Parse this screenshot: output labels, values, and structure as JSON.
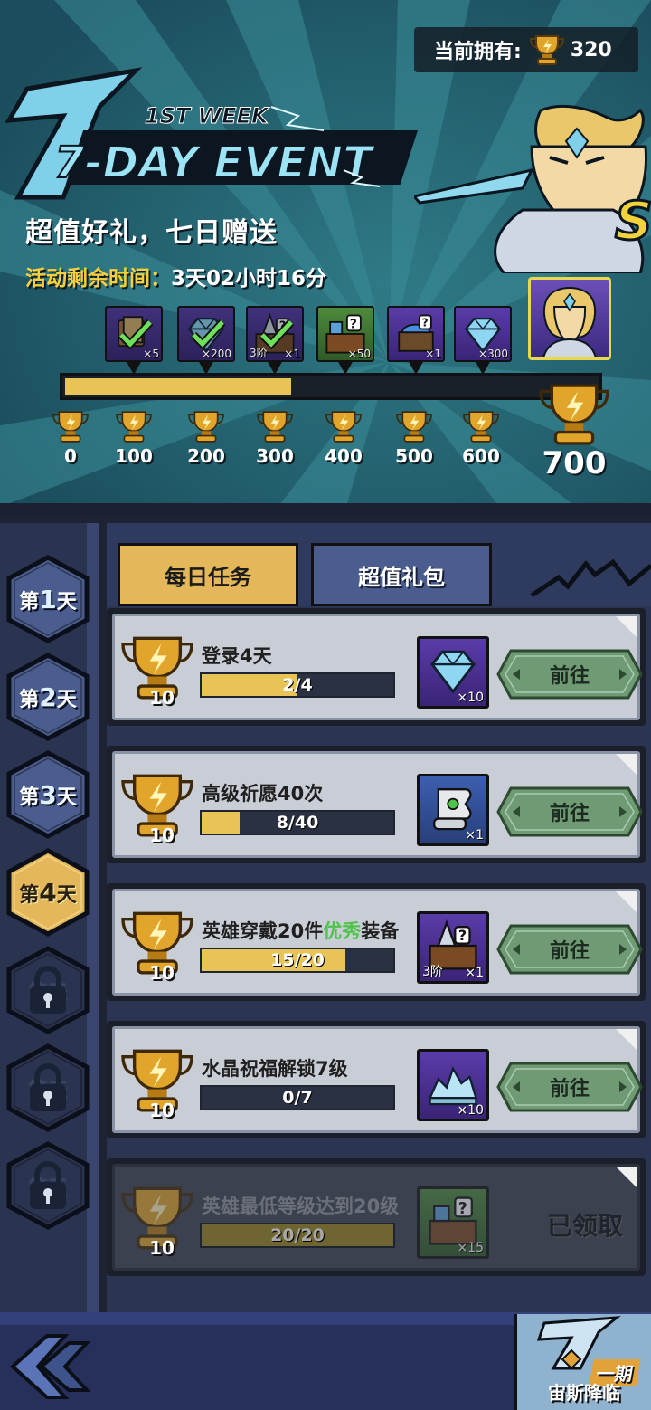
{
  "header": {
    "owned_label": "当前拥有:",
    "owned_value": "320",
    "logo_week": "1ST WEEK",
    "logo_title": "7-DAY EVENT",
    "subtitle": "超值好礼，七日赠送",
    "timer_label": "活动剩余时间：",
    "timer_value": "3天02小时16分",
    "hero_grade": "S"
  },
  "progress": {
    "current": 320,
    "max": 700,
    "milestones": [
      "0",
      "100",
      "200",
      "300",
      "400",
      "500",
      "600"
    ],
    "final_milestone": "700",
    "rewards": [
      {
        "icon": "book-icon",
        "qty": "×5",
        "claimed": true
      },
      {
        "icon": "diamond-icon",
        "qty": "×200",
        "claimed": true
      },
      {
        "icon": "equipment-chest-icon",
        "tier": "3阶",
        "qty": "×1",
        "claimed": true
      },
      {
        "icon": "mystery-chest-icon",
        "qty": "×50",
        "claimed": false
      },
      {
        "icon": "blue-chest-icon",
        "qty": "×1",
        "claimed": false
      },
      {
        "icon": "diamond-icon",
        "qty": "×300",
        "claimed": false
      }
    ]
  },
  "days": [
    {
      "label_pre": "第",
      "num": "1",
      "label_post": "天",
      "state": "normal"
    },
    {
      "label_pre": "第",
      "num": "2",
      "label_post": "天",
      "state": "normal"
    },
    {
      "label_pre": "第",
      "num": "3",
      "label_post": "天",
      "state": "normal"
    },
    {
      "label_pre": "第",
      "num": "4",
      "label_post": "天",
      "state": "active"
    },
    {
      "label_pre": "第",
      "num": "",
      "label_post": "天",
      "state": "locked"
    },
    {
      "label_pre": "第",
      "num": "",
      "label_post": "天",
      "state": "locked"
    },
    {
      "label_pre": "第",
      "num": "",
      "label_post": "天",
      "state": "locked"
    }
  ],
  "tabs": {
    "daily": "每日任务",
    "bundle": "超值礼包"
  },
  "tasks": [
    {
      "points": "10",
      "title": "登录4天",
      "title_hl": "",
      "title_post": "",
      "progress": "2/4",
      "ratio": 0.5,
      "item_icon": "diamond-icon",
      "item_qty": "×10",
      "item_tier": "",
      "button": "前往",
      "done": false
    },
    {
      "points": "10",
      "title": "高级祈愿40次",
      "title_hl": "",
      "title_post": "",
      "progress": "8/40",
      "ratio": 0.2,
      "item_icon": "scroll-icon",
      "item_qty": "×1",
      "item_tier": "",
      "button": "前往",
      "done": false
    },
    {
      "points": "10",
      "title": "英雄穿戴20件",
      "title_hl": "优秀",
      "title_post": "装备",
      "progress": "15/20",
      "ratio": 0.75,
      "item_icon": "equipment-chest-icon",
      "item_qty": "×1",
      "item_tier": "3阶",
      "button": "前往",
      "done": false
    },
    {
      "points": "10",
      "title": "水晶祝福解锁7级",
      "title_hl": "",
      "title_post": "",
      "progress": "0/7",
      "ratio": 0,
      "item_icon": "crystal-shards-icon",
      "item_qty": "×10",
      "item_tier": "",
      "button": "前往",
      "done": false
    },
    {
      "points": "10",
      "title": "英雄最低等级达到20级",
      "title_hl": "",
      "title_post": "",
      "progress": "20/20",
      "ratio": 1,
      "item_icon": "mystery-chest-icon",
      "item_qty": "×15",
      "item_tier": "",
      "button": "已领取",
      "done": true
    }
  ],
  "bottom": {
    "zeus_tag": "一期",
    "zeus_label": "宙斯降临"
  },
  "colors": {
    "accent_gold": "#e8c456",
    "banner_teal": "#226070",
    "go_button_green": "#6f9a74"
  }
}
